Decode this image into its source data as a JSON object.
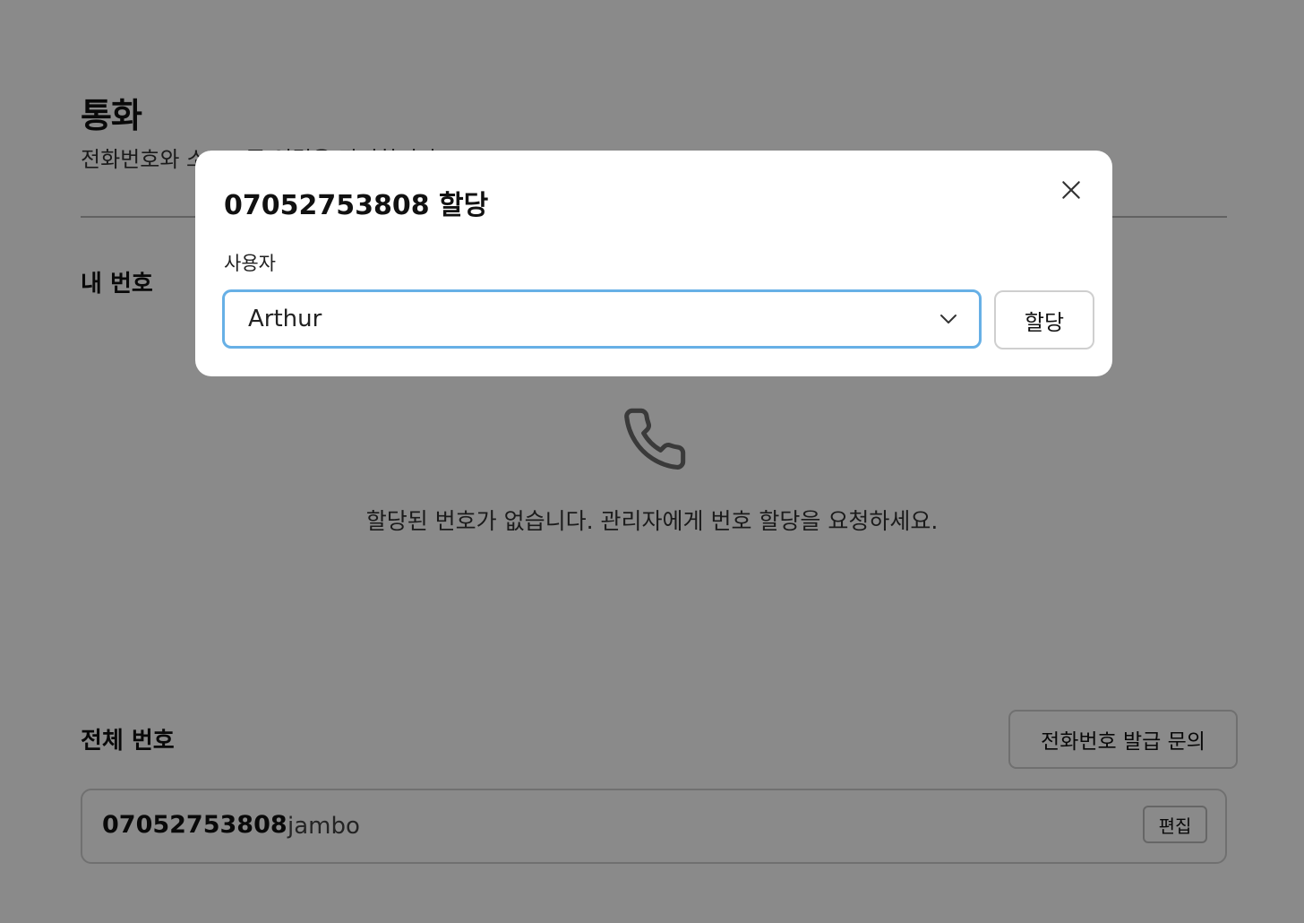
{
  "page": {
    "title": "통화",
    "subtitle": "전화번호와 소프트폰 연결을 관리합니다.",
    "my_numbers": {
      "heading": "내 번호",
      "empty_icon": "phone-icon",
      "empty_text": "할당된 번호가 없습니다. 관리자에게 번호 할당을 요청하세요."
    },
    "all_numbers": {
      "heading": "전체 번호",
      "inquiry_button": "전화번호 발급 문의",
      "rows": [
        {
          "number": "07052753808",
          "name": "jambo",
          "edit_label": "편집"
        }
      ]
    }
  },
  "modal": {
    "title": "07052753808 할당",
    "close_icon": "close-icon",
    "field_label": "사용자",
    "selected_user": "Arthur",
    "assign_button": "할당",
    "colors": {
      "focus_border": "#67b0e6",
      "overlay": "rgba(0,0,0,0.46)"
    }
  }
}
